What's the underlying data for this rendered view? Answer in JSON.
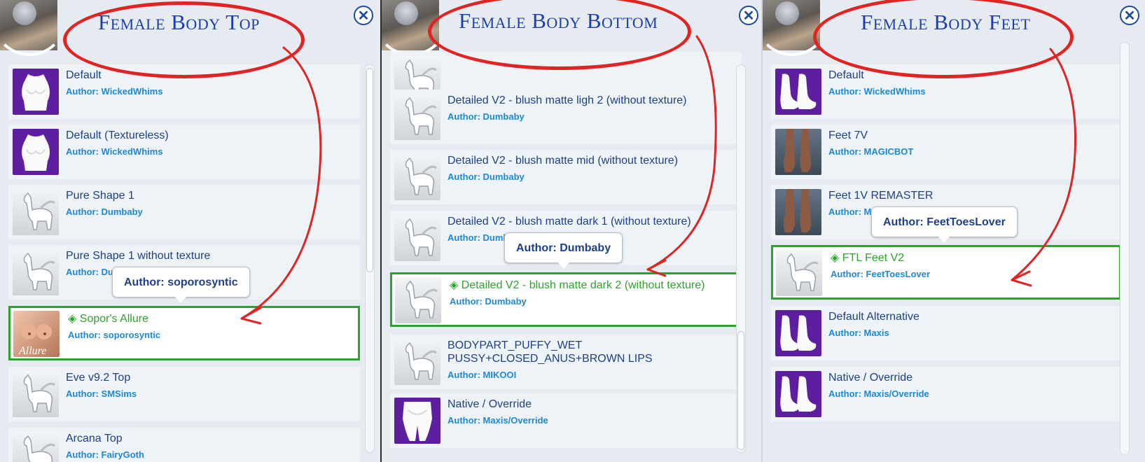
{
  "panels": [
    {
      "title": "Female Body Top",
      "tooltip": "Author: soporosyntic",
      "items": [
        {
          "name": "Default",
          "author": "Author: WickedWhims",
          "thumb": "body-top-icon"
        },
        {
          "name": "Default (Textureless)",
          "author": "Author: WickedWhims",
          "thumb": "body-top-icon"
        },
        {
          "name": "Pure Shape 1",
          "author": "Author: Dumbaby",
          "thumb": "llama-icon"
        },
        {
          "name": "Pure Shape 1 without texture",
          "author": "Author: Dumbaby",
          "thumb": "llama-icon"
        },
        {
          "name": "Sopor's Allure",
          "author": "Author: soporosyntic",
          "thumb": "allure-photo",
          "selected": true,
          "marker": "◈"
        },
        {
          "name": "Eve v9.2 Top",
          "author": "Author: SMSims",
          "thumb": "llama-icon"
        },
        {
          "name": "Arcana Top",
          "author": "Author: FairyGoth",
          "thumb": "llama-icon"
        }
      ]
    },
    {
      "title": "Female Body Bottom",
      "tooltip": "Author: Dumbaby",
      "items": [
        {
          "name": "",
          "author": "",
          "thumb": "llama-icon"
        },
        {
          "name": "Detailed V2 - blush matte ligh 2 (without texture)",
          "author": "Author: Dumbaby",
          "thumb": "llama-icon"
        },
        {
          "name": "Detailed V2 - blush matte mid (without texture)",
          "author": "Author: Dumbaby",
          "thumb": "llama-icon"
        },
        {
          "name": "Detailed V2 - blush matte dark 1 (without texture)",
          "author": "Author: Dumbaby",
          "thumb": "llama-icon"
        },
        {
          "name": "Detailed V2 - blush matte dark 2 (without texture)",
          "author": "Author: Dumbaby",
          "thumb": "llama-icon",
          "selected": true,
          "marker": "◈"
        },
        {
          "name": "BODYPART_PUFFY_WET PUSSY+CLOSED_ANUS+BROWN LIPS",
          "author": "Author: MIKOOI",
          "thumb": "llama-icon"
        },
        {
          "name": "Native / Override",
          "author": "Author: Maxis/Override",
          "thumb": "body-bottom-icon"
        }
      ]
    },
    {
      "title": "Female Body Feet",
      "tooltip": "Author: FeetToesLover",
      "items": [
        {
          "name": "Default",
          "author": "Author: WickedWhims",
          "thumb": "feet-icon"
        },
        {
          "name": "Feet 7V",
          "author": "Author: MAGICBOT",
          "thumb": "feet-photo"
        },
        {
          "name": "Feet 1V REMASTER",
          "author": "Author: MAGICBOT",
          "thumb": "feet-photo"
        },
        {
          "name": "FTL Feet V2",
          "author": "Author: FeetToesLover",
          "thumb": "llama-icon",
          "selected": true,
          "marker": "◈"
        },
        {
          "name": "Default Alternative",
          "author": "Author: Maxis",
          "thumb": "feet-icon"
        },
        {
          "name": "Native / Override",
          "author": "Author: Maxis/Override",
          "thumb": "feet-icon"
        }
      ]
    }
  ],
  "close_glyph": "✕",
  "colors": {
    "selected_border": "#2da32d",
    "title": "#1e3fa8",
    "annotation": "#e02424",
    "author": "#1e88d6",
    "name": "#1f3f86",
    "purple_thumb": "#5d1f9f"
  }
}
